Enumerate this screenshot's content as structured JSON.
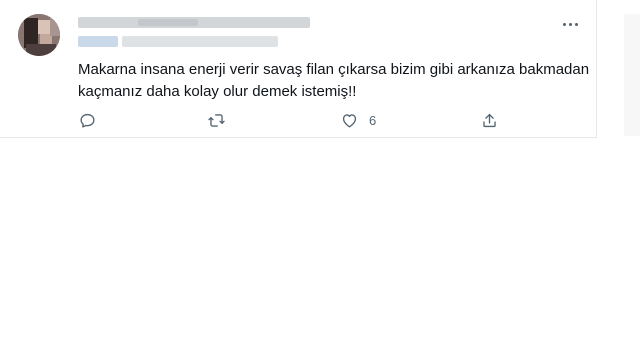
{
  "tweet": {
    "text_line_1": "Makarna insana enerji verir savaş filan çıkarsa bizim gibi arkanıza bakmadan",
    "text_line_2": "kaçmanız daha kolay olur demek istemiş!!",
    "like_count": "6"
  },
  "icons": {
    "more": "more-horizontal-icon",
    "reply": "reply-bubble-icon",
    "retweet": "retweet-icon",
    "like": "heart-icon",
    "share": "share-upload-icon"
  },
  "colors": {
    "text": "#0f1419",
    "icon": "#536471",
    "border": "#e7e7e7"
  }
}
